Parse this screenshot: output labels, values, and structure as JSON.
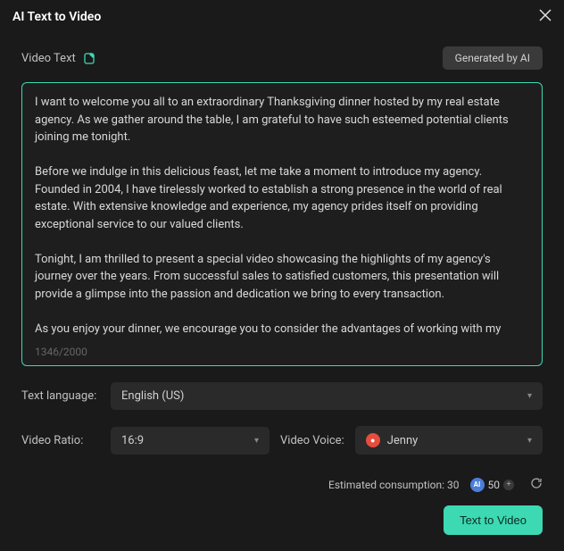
{
  "header": {
    "title": "AI Text to Video"
  },
  "section": {
    "label": "Video Text",
    "generated_badge": "Generated by AI"
  },
  "textarea": {
    "value": "I want to welcome you all to an extraordinary Thanksgiving dinner hosted by my real estate agency. As we gather around the table, I am grateful to have such esteemed potential clients joining me tonight.\n\nBefore we indulge in this delicious feast, let me take a moment to introduce my agency. Founded in 2004, I have tirelessly worked to establish a strong presence in the world of real estate. With extensive knowledge and experience, my agency prides itself on providing exceptional service to our valued clients.\n\nTonight, I am thrilled to present a special video showcasing the highlights of my agency's journey over the years. From successful sales to satisfied customers, this presentation will provide a glimpse into the passion and dedication we bring to every transaction.\n\nAs you enjoy your dinner, we encourage you to consider the advantages of working with my agency. Our team of experts is committed to understanding your unique needs and finding the perfect property that aligns with your desires. With a proven track record of excellence, we ensure a stress-free and smooth real estate experience.\n\nThank you for joining us tonight and being a part of this special occasion. May this Thanksgiving",
    "count": "1346/2000"
  },
  "language": {
    "label": "Text language:",
    "value": "English (US)"
  },
  "ratio": {
    "label": "Video Ratio:",
    "value": "16:9"
  },
  "voice": {
    "label": "Video Voice:",
    "value": "Jenny"
  },
  "footer": {
    "consumption_label": "Estimated consumption:",
    "consumption_value": "30",
    "credits": "50"
  },
  "action": {
    "button": "Text to Video"
  }
}
